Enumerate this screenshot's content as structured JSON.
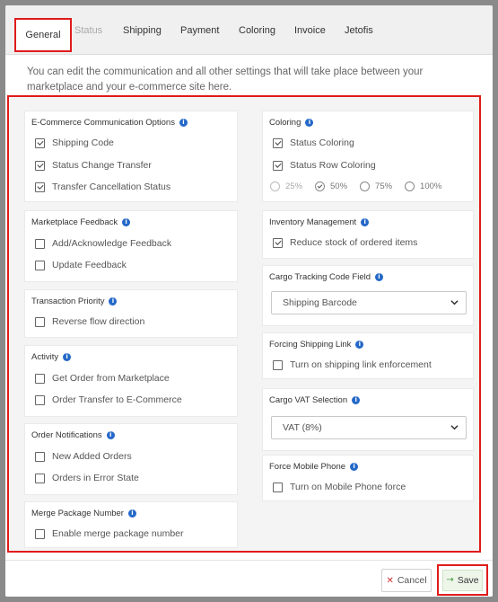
{
  "tabs": [
    {
      "label": "General",
      "active": true
    },
    {
      "label": "Status",
      "disabled": true
    },
    {
      "label": "Shipping"
    },
    {
      "label": "Payment"
    },
    {
      "label": "Coloring"
    },
    {
      "label": "Invoice"
    },
    {
      "label": "Jetofis"
    }
  ],
  "intro_text": "You can edit the communication and all other settings that will take place between your marketplace and your e-commerce site here.",
  "left": {
    "ecommerce": {
      "title": "E-Commerce Communication Options",
      "options": [
        {
          "label": "Shipping Code",
          "checked": true
        },
        {
          "label": "Status Change Transfer",
          "checked": true
        },
        {
          "label": "Transfer Cancellation Status",
          "checked": true
        }
      ]
    },
    "feedback": {
      "title": "Marketplace Feedback",
      "options": [
        {
          "label": "Add/Acknowledge Feedback",
          "checked": false
        },
        {
          "label": "Update Feedback",
          "checked": false
        }
      ]
    },
    "priority": {
      "title": "Transaction Priority",
      "options": [
        {
          "label": "Reverse flow direction",
          "checked": false
        }
      ]
    },
    "activity": {
      "title": "Activity",
      "options": [
        {
          "label": "Get Order from Marketplace",
          "checked": false
        },
        {
          "label": "Order Transfer to E-Commerce",
          "checked": false
        }
      ]
    },
    "notifications": {
      "title": "Order Notifications",
      "options": [
        {
          "label": "New Added Orders",
          "checked": false
        },
        {
          "label": "Orders in Error State",
          "checked": false
        }
      ]
    },
    "merge": {
      "title": "Merge Package Number",
      "options": [
        {
          "label": "Enable merge package number",
          "checked": false
        }
      ]
    }
  },
  "right": {
    "coloring": {
      "title": "Coloring",
      "options": [
        {
          "label": "Status Coloring",
          "checked": true
        },
        {
          "label": "Status Row Coloring",
          "checked": true
        }
      ],
      "opacity": [
        {
          "label": "25%",
          "disabled": true
        },
        {
          "label": "50%",
          "checked": true
        },
        {
          "label": "75%"
        },
        {
          "label": "100%"
        }
      ]
    },
    "inventory": {
      "title": "Inventory Management",
      "options": [
        {
          "label": "Reduce stock of ordered items",
          "checked": true
        }
      ]
    },
    "cargo_code": {
      "title": "Cargo Tracking Code Field",
      "selected": "Shipping Barcode"
    },
    "shipping_link": {
      "title": "Forcing Shipping Link",
      "options": [
        {
          "label": "Turn on shipping link enforcement",
          "checked": false
        }
      ]
    },
    "vat": {
      "title": "Cargo VAT Selection",
      "selected": "VAT (8%)"
    },
    "mobile": {
      "title": "Force Mobile Phone",
      "options": [
        {
          "label": "Turn on Mobile Phone force",
          "checked": false
        }
      ]
    }
  },
  "footer": {
    "cancel_label": "Cancel",
    "save_label": "Save"
  },
  "colors": {
    "highlight": "#e01b1b",
    "info_icon": "#2468c8",
    "save_arrow": "#3a9a3a",
    "cancel_x": "#cc3333"
  }
}
